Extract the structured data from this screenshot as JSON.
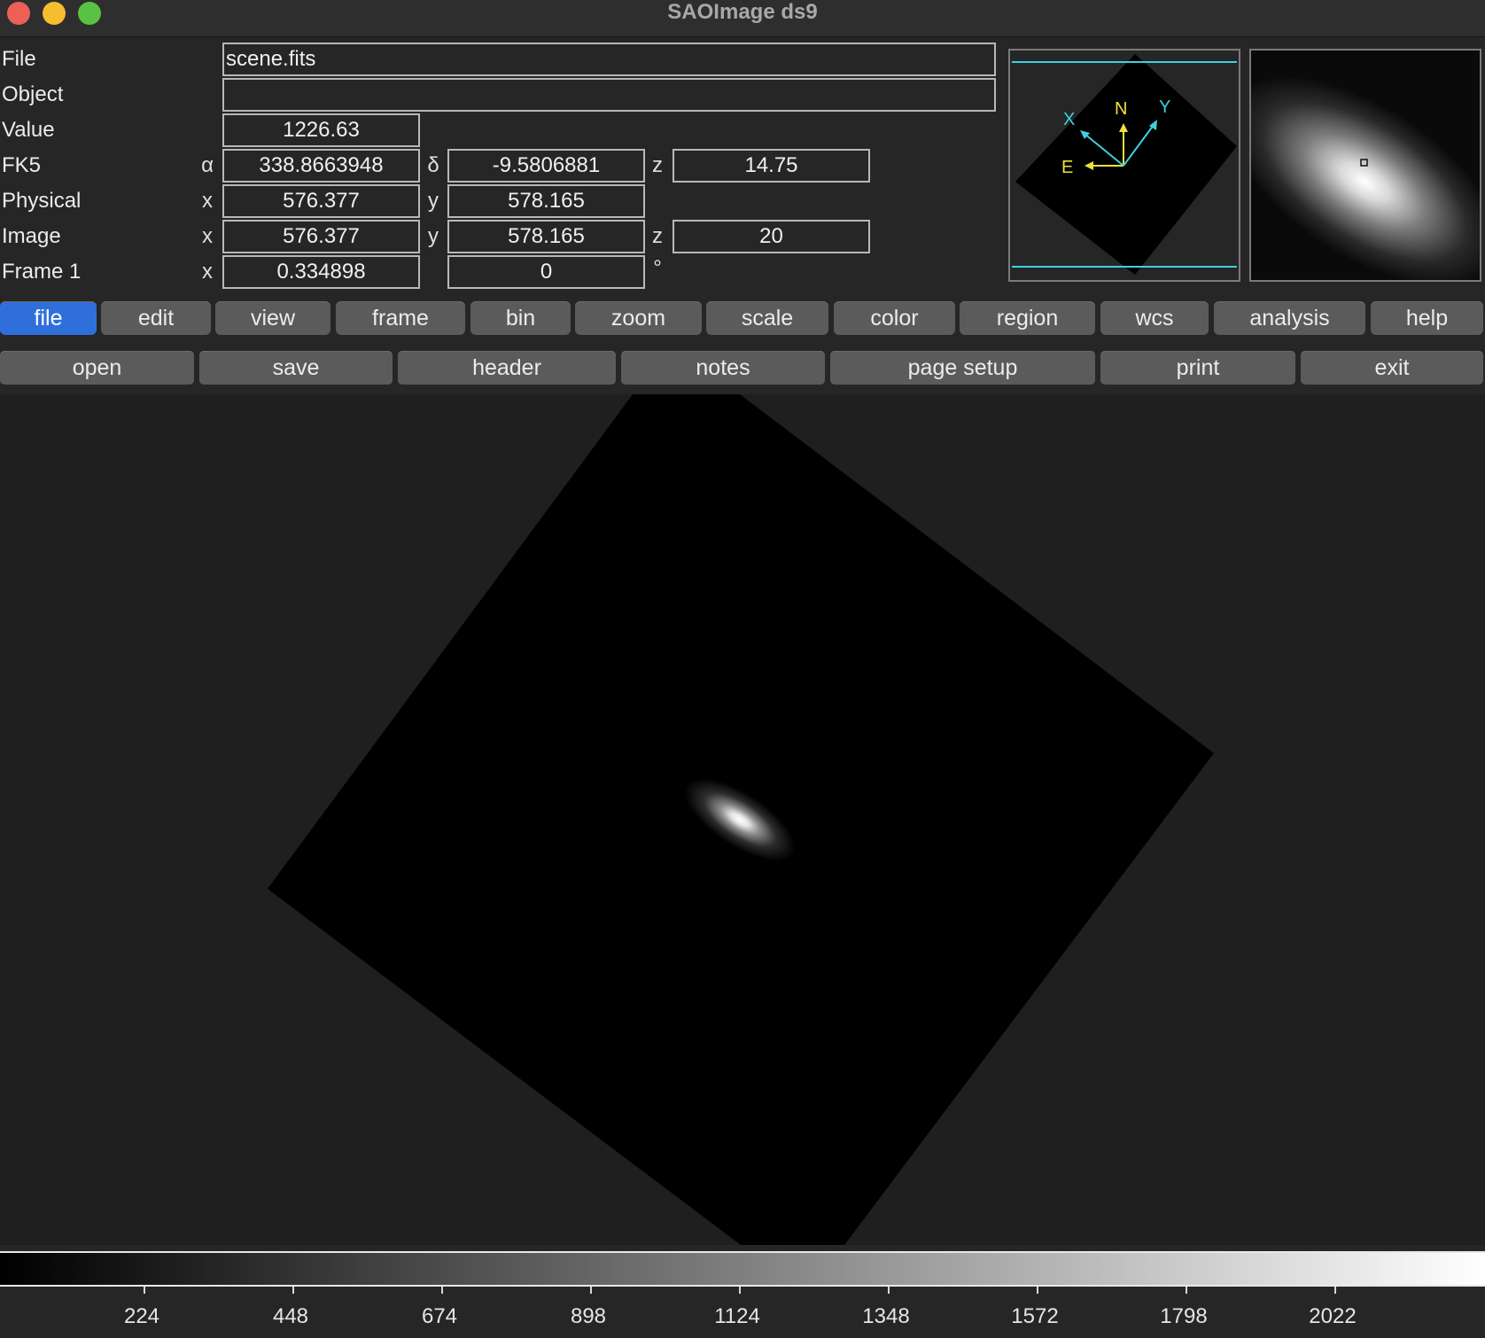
{
  "window": {
    "title": "SAOImage ds9",
    "buttons": [
      "close",
      "minimize",
      "maximize"
    ]
  },
  "info_panel": {
    "labels": {
      "file": "File",
      "object": "Object",
      "value": "Value",
      "fk5": "FK5",
      "physical": "Physical",
      "image": "Image",
      "frame": "Frame 1"
    },
    "file_value": "scene.fits",
    "object_value": "",
    "value_value": "1226.63",
    "fk5": {
      "alpha_symbol": "α",
      "alpha": "338.8663948",
      "delta_symbol": "δ",
      "delta": "-9.5806881",
      "z_label": "z",
      "z": "14.75"
    },
    "physical": {
      "x_label": "x",
      "x": "576.377",
      "y_label": "y",
      "y": "578.165"
    },
    "image": {
      "x_label": "x",
      "x": "576.377",
      "y_label": "y",
      "y": "578.165",
      "z_label": "z",
      "z": "20"
    },
    "frame": {
      "x_label": "x",
      "zoom": "0.334898",
      "angle": "0",
      "degree_symbol": "°"
    }
  },
  "panner": {
    "compass_labels": {
      "x": "X",
      "n": "N",
      "y": "Y",
      "e": "E"
    },
    "colors": {
      "wcs_axes": "#f0e040",
      "image_axes": "#40d0e0",
      "frame_box": "#40d0e0"
    }
  },
  "menubar": {
    "items": [
      {
        "label": "file",
        "active": true
      },
      {
        "label": "edit",
        "active": false
      },
      {
        "label": "view",
        "active": false
      },
      {
        "label": "frame",
        "active": false
      },
      {
        "label": "bin",
        "active": false
      },
      {
        "label": "zoom",
        "active": false
      },
      {
        "label": "scale",
        "active": false
      },
      {
        "label": "color",
        "active": false
      },
      {
        "label": "region",
        "active": false
      },
      {
        "label": "wcs",
        "active": false
      },
      {
        "label": "analysis",
        "active": false
      },
      {
        "label": "help",
        "active": false
      }
    ]
  },
  "buttonbar": {
    "items": [
      "open",
      "save",
      "header",
      "notes",
      "page setup",
      "print",
      "exit"
    ]
  },
  "colorbar": {
    "tick_labels": [
      "224",
      "448",
      "674",
      "898",
      "1124",
      "1348",
      "1572",
      "1798",
      "2022"
    ]
  },
  "colors": {
    "accent": "#2f6fdc",
    "button": "#5b5b5b",
    "background": "#262626"
  }
}
